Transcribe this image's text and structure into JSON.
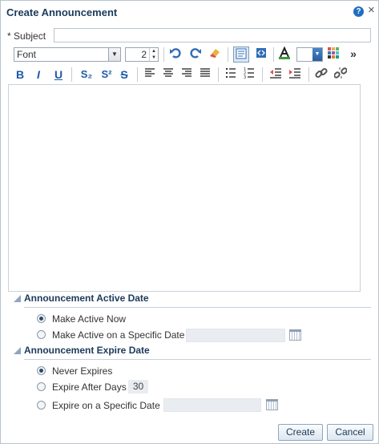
{
  "dialog": {
    "title": "Create Announcement",
    "help_glyph": "?",
    "close_glyph": "×"
  },
  "subject": {
    "required_mark": "*",
    "label": "Subject",
    "value": ""
  },
  "toolbar": {
    "font_label": "Font",
    "font_size": "2",
    "more_glyph": "»",
    "icons": [
      "undo-icon",
      "redo-icon",
      "clear-format-icon",
      "rich-text-mode-icon",
      "source-mode-icon",
      "text-color-icon",
      "highlight-color-icon",
      "color-palette-icon",
      "more-icon"
    ],
    "format_buttons": {
      "bold": "B",
      "italic": "I",
      "underline": "U",
      "subscript": "S₂",
      "superscript": "S²",
      "strikethrough": "S"
    }
  },
  "active_section": {
    "title": "Announcement Active Date",
    "options": [
      {
        "label": "Make Active Now",
        "checked": true
      },
      {
        "label": "Make Active on a Specific Date",
        "checked": false
      }
    ]
  },
  "expire_section": {
    "title": "Announcement Expire Date",
    "options": [
      {
        "label": "Never Expires",
        "checked": true
      },
      {
        "label": "Expire After Days",
        "checked": false
      },
      {
        "label": "Expire on a Specific Date",
        "checked": false
      }
    ],
    "days_value": "30"
  },
  "buttons": {
    "create": "Create",
    "cancel": "Cancel"
  },
  "colors": {
    "accent": "#1b3a5c",
    "toolbar_blue": "#1f5aa8",
    "border": "#b9c4cf"
  }
}
